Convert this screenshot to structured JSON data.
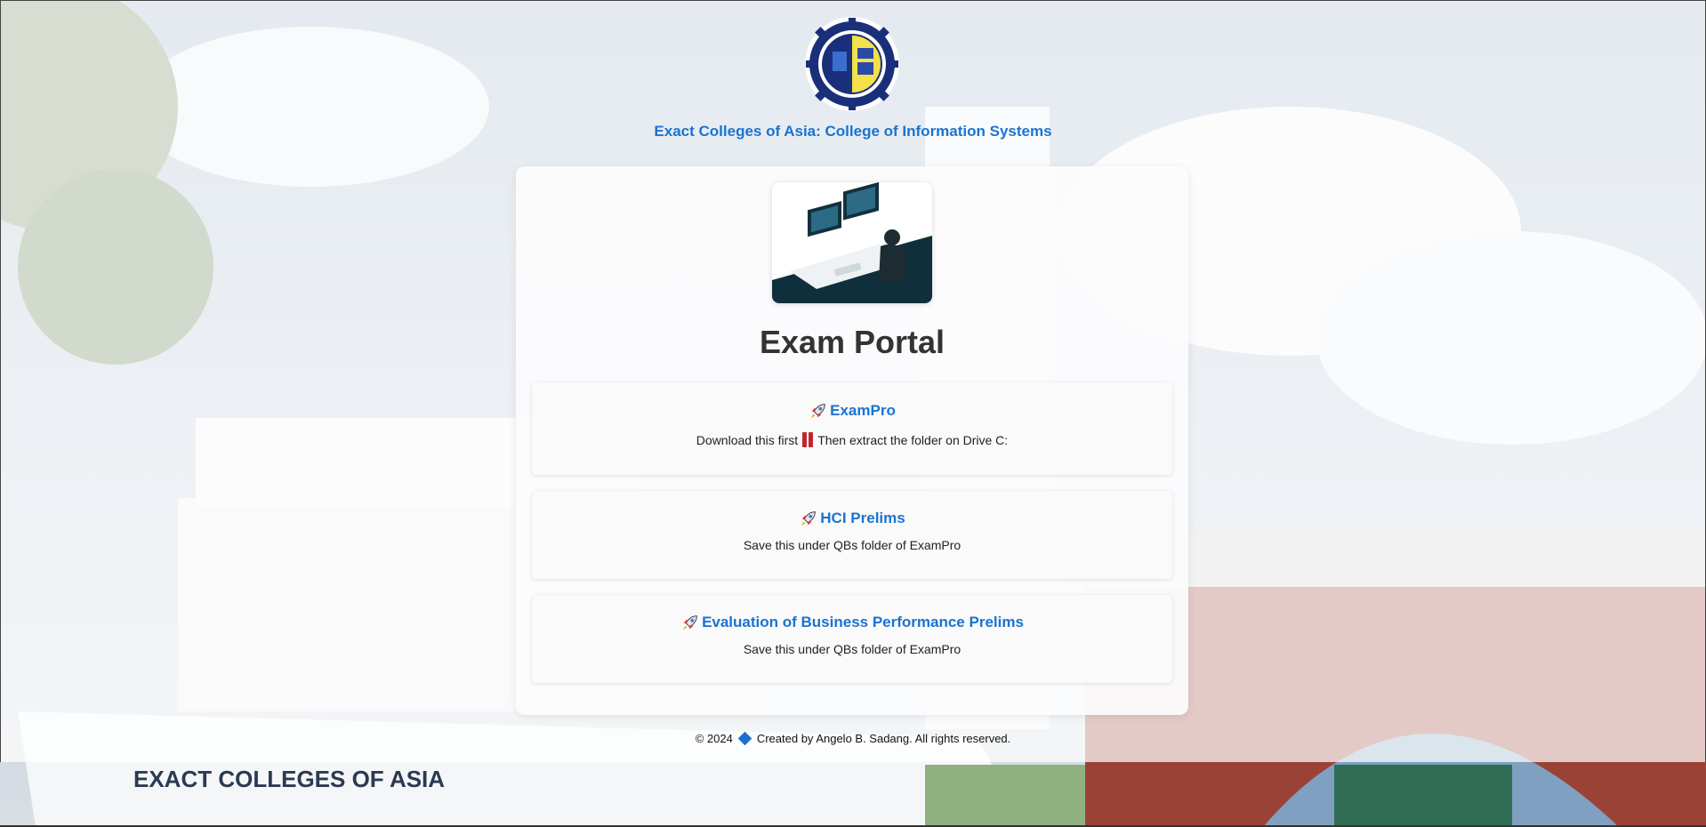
{
  "header": {
    "title": "Exact Colleges of Asia: College of Information Systems",
    "logo_icon": "college-of-information-systems-seal"
  },
  "main": {
    "title": "Exam Portal",
    "hero_icon": "person-at-dual-monitors-illustration",
    "items": [
      {
        "icon": "rocket-icon",
        "label": "ExamPro",
        "desc_before": "Download this first",
        "desc_after": "Then extract the folder on Drive C:"
      },
      {
        "icon": "rocket-icon",
        "label": "HCI Prelims",
        "desc": "Save this under QBs folder of ExamPro"
      },
      {
        "icon": "rocket-icon",
        "label": "Evaluation of Business Performance Prelims",
        "desc": "Save this under QBs folder of ExamPro"
      }
    ]
  },
  "footer": {
    "left": "© 2024",
    "right": "Created by Angelo B. Sadang. All rights reserved."
  },
  "colors": {
    "accent": "#1a73d1",
    "heading": "#333333",
    "alert": "#c0272d"
  }
}
